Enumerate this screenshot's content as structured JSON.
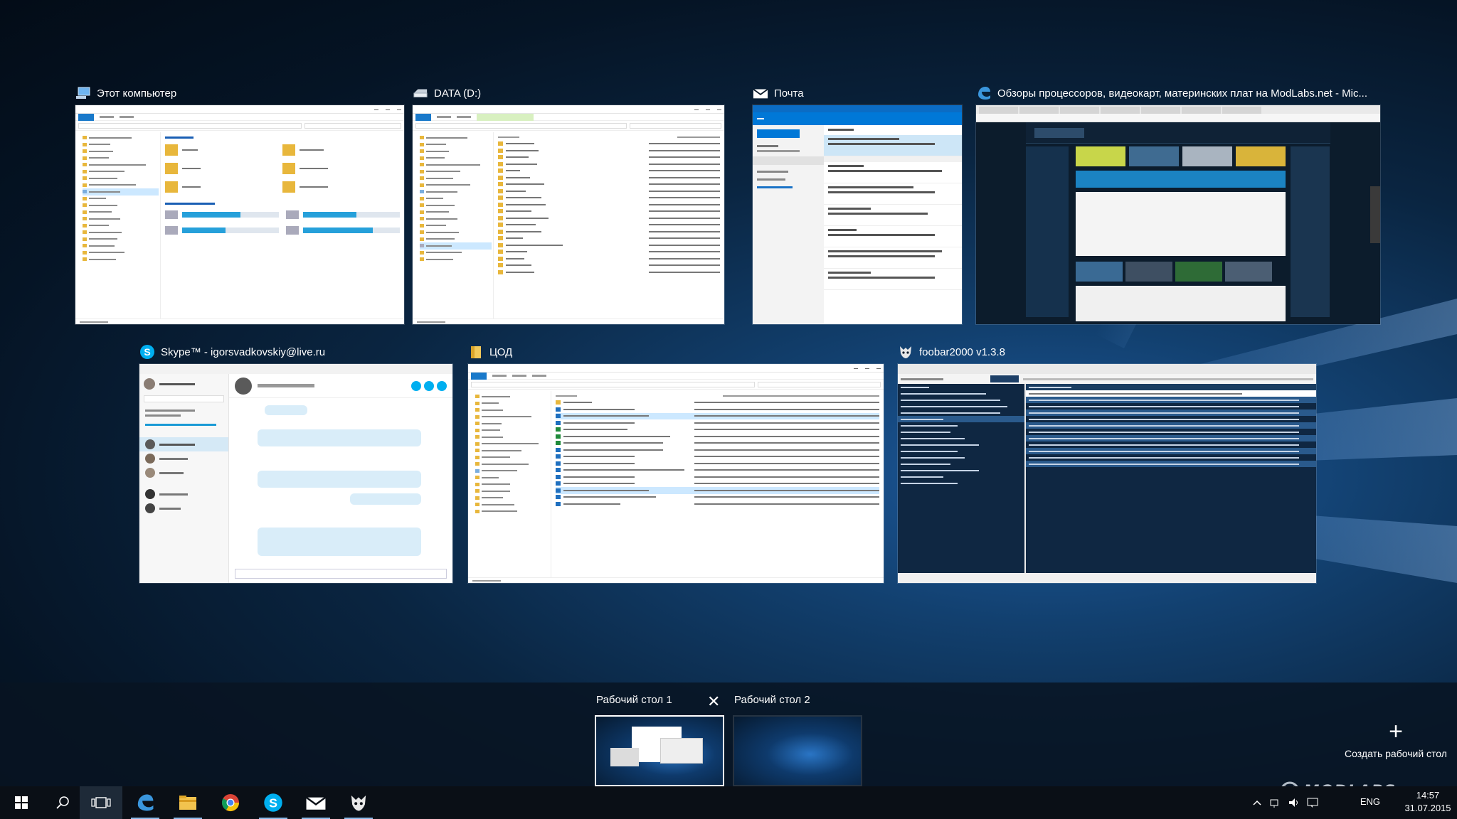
{
  "windows": {
    "computer": {
      "title": "Этот компьютер",
      "icon": "computer-icon"
    },
    "data_drive": {
      "title": "DATA (D:)",
      "icon": "drive-icon"
    },
    "mail": {
      "title": "Почта",
      "icon": "mail-icon"
    },
    "edge": {
      "title": "Обзоры процессоров, видеокарт, материнских плат на ModLabs.net - Mic...",
      "icon": "edge-icon"
    },
    "skype": {
      "title": "Skype™ - igorsvadkovskiy@live.ru",
      "icon": "skype-icon"
    },
    "tsod": {
      "title": "ЦОД",
      "icon": "folder-icon"
    },
    "foobar": {
      "title": "foobar2000 v1.3.8",
      "icon": "foobar-icon"
    }
  },
  "desktops": {
    "items": [
      {
        "label": "Рабочий стол 1",
        "active": true
      },
      {
        "label": "Рабочий стол 2",
        "active": false
      }
    ],
    "new_label": "Создать рабочий стол"
  },
  "taskbar": {
    "buttons": [
      "start-icon",
      "search-icon",
      "task-view-icon",
      "edge-icon",
      "file-explorer-icon",
      "chrome-icon",
      "skype-icon",
      "mail-icon",
      "foobar-icon"
    ],
    "language": "ENG",
    "time": "14:57",
    "date": "31.07.2015"
  },
  "watermark": "MODLABS",
  "colors": {
    "accent": "#0078d7",
    "explorer_folder": "#e8b73c",
    "taskbar": "#0a0f16"
  }
}
